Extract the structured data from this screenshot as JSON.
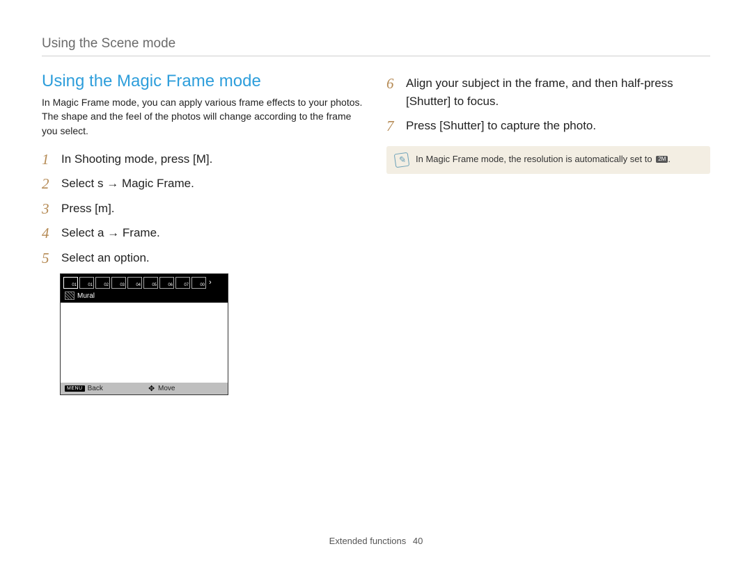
{
  "header": {
    "breadcrumb": "Using the Scene mode"
  },
  "section": {
    "title": "Using the Magic Frame mode",
    "intro": "In Magic Frame mode, you can apply various frame effects to your photos. The shape and the feel of the photos will change according to the frame you select."
  },
  "steps_left": [
    {
      "n": "1",
      "pre": "In Shooting mode, press [",
      "mid": "M",
      "post": "]."
    },
    {
      "n": "2",
      "pre": "Select ",
      "mid": "s",
      "arrow": " → ",
      "post": "Magic Frame."
    },
    {
      "n": "3",
      "pre": "Press [",
      "mid": "m",
      "post": "]."
    },
    {
      "n": "4",
      "pre": "Select ",
      "mid": "a",
      "arrow": " → ",
      "post": "Frame."
    },
    {
      "n": "5",
      "pre": "Select an option.",
      "mid": "",
      "post": ""
    }
  ],
  "steps_right": [
    {
      "n": "6",
      "text": "Align your subject in the frame, and then half-press [Shutter] to focus."
    },
    {
      "n": "7",
      "text": "Press [Shutter] to capture the photo."
    }
  ],
  "note": {
    "text_a": "In Magic Frame mode, the resolution is automatically set to ",
    "res_badge": "2M",
    "text_b": "."
  },
  "device": {
    "thumbs": [
      "01",
      "01",
      "02",
      "03",
      "04",
      "05",
      "06",
      "07",
      "00"
    ],
    "label": "Mural",
    "footer_back_label": "Back",
    "footer_back_btn": "MENU",
    "footer_move_label": "Move"
  },
  "footer": {
    "section": "Extended functions",
    "page": "40"
  }
}
